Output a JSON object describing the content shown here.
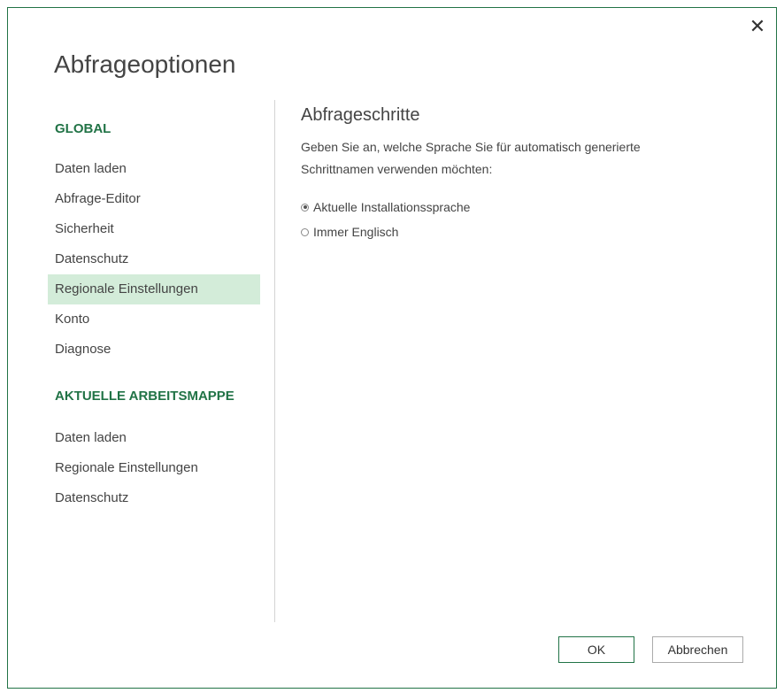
{
  "dialog": {
    "title": "Abfrageoptionen",
    "close_symbol": "✕"
  },
  "sidebar": {
    "global_header": "GLOBAL",
    "global_items": [
      {
        "label": "Daten laden"
      },
      {
        "label": "Abfrage-Editor"
      },
      {
        "label": "Sicherheit"
      },
      {
        "label": "Datenschutz"
      },
      {
        "label": "Regionale Einstellungen",
        "selected": true
      },
      {
        "label": "Konto"
      },
      {
        "label": "Diagnose"
      }
    ],
    "workbook_header": "AKTUELLE ARBEITSMAPPE",
    "workbook_items": [
      {
        "label": "Daten laden"
      },
      {
        "label": "Regionale Einstellungen"
      },
      {
        "label": "Datenschutz"
      }
    ]
  },
  "content": {
    "title": "Abfrageschritte",
    "description_line1": "Geben Sie an, welche Sprache Sie für automatisch generierte",
    "description_line2": "Schrittnamen verwenden möchten:",
    "options": [
      {
        "label": "Aktuelle Installationssprache",
        "checked": true
      },
      {
        "label": "Immer Englisch",
        "checked": false
      }
    ]
  },
  "buttons": {
    "ok_label": "OK",
    "cancel_label": "Abbrechen"
  },
  "colors": {
    "accent": "#217346",
    "selected_bg": "#d3ecd9"
  }
}
